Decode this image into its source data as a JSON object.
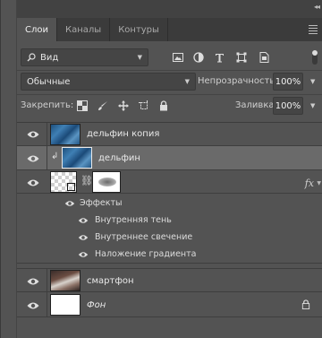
{
  "tabs": [
    {
      "label": "Слои",
      "active": true
    },
    {
      "label": "Каналы",
      "active": false
    },
    {
      "label": "Контуры",
      "active": false
    }
  ],
  "filter": {
    "kind_label": "Вид",
    "icons": [
      "image-filter-icon",
      "adjustment-filter-icon",
      "type-filter-icon",
      "shape-filter-icon",
      "smart-object-filter-icon"
    ]
  },
  "blend": {
    "mode": "Обычные",
    "opacity_label": "Непрозрачность:",
    "opacity_value": "100%"
  },
  "lock": {
    "label": "Закрепить:",
    "fill_label": "Заливка:",
    "fill_value": "100%"
  },
  "layers": [
    {
      "name": "дельфин копия",
      "selected": false,
      "visible": true
    },
    {
      "name": "дельфин",
      "selected": true,
      "visible": true,
      "clipped": true
    },
    {
      "name": "",
      "selected": false,
      "visible": true,
      "has_effects": true,
      "fx_label": "fx"
    },
    {
      "name": "смартфон",
      "selected": false,
      "visible": true
    },
    {
      "name": "Фон",
      "selected": false,
      "visible": true,
      "locked": true
    }
  ],
  "effects": {
    "header": "Эффекты",
    "items": [
      "Внутренняя тень",
      "Внутреннее свечение",
      "Наложение градиента"
    ]
  },
  "colors": {
    "panel_bg": "#535353",
    "selected_bg": "#6a6a6a",
    "tab_bar": "#3b3b3b"
  }
}
